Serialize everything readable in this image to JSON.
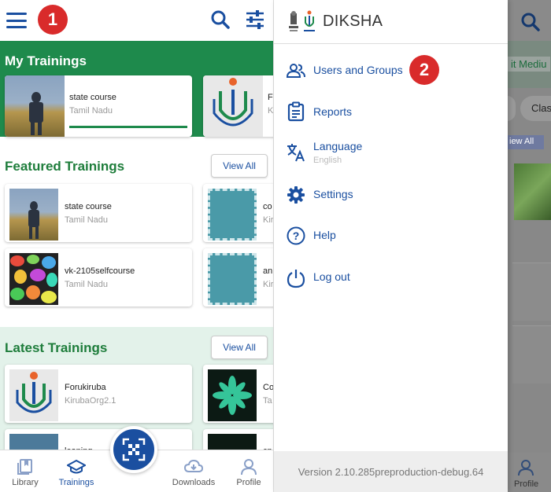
{
  "annotations": {
    "badge_1": "1",
    "badge_2": "2"
  },
  "sections": {
    "my_trainings": {
      "title": "My Trainings",
      "cards": [
        {
          "title": "state course",
          "subtitle": "Tamil Nadu"
        },
        {
          "title": "F",
          "subtitle": "K"
        }
      ]
    },
    "featured": {
      "title": "Featured Trainings",
      "view_all": "View All",
      "cards": [
        {
          "title": "state course",
          "subtitle": "Tamil Nadu"
        },
        {
          "title": "co",
          "subtitle": "Kir"
        },
        {
          "title": "vk-2105selfcourse",
          "subtitle": "Tamil Nadu"
        },
        {
          "title": "an",
          "subtitle": "Kir"
        }
      ]
    },
    "latest": {
      "title": "Latest Trainings",
      "view_all": "View All",
      "cards": [
        {
          "title": "Forukiruba",
          "subtitle": "KirubaOrg2.1"
        },
        {
          "title": "Co",
          "subtitle": "Ta"
        },
        {
          "title": "leaning",
          "subtitle": ""
        },
        {
          "title": "cp",
          "subtitle": ""
        }
      ]
    }
  },
  "bottom_nav": {
    "library": "Library",
    "trainings": "Trainings",
    "downloads": "Downloads",
    "profile": "Profile"
  },
  "drawer": {
    "brand": "DIKSHA",
    "items": [
      {
        "label": "Users and Groups",
        "icon": "users-icon"
      },
      {
        "label": "Reports",
        "icon": "clipboard-icon"
      },
      {
        "label": "Language",
        "sub": "English",
        "icon": "translate-icon"
      },
      {
        "label": "Settings",
        "icon": "gear-icon"
      },
      {
        "label": "Help",
        "icon": "help-icon"
      },
      {
        "label": "Log out",
        "icon": "power-icon"
      }
    ],
    "version": "Version 2.10.285preproduction-debug.64"
  },
  "scrim": {
    "chip_medium": "it Mediu",
    "chip_class": "Clas",
    "view_all": "iew All",
    "profile": "Profile"
  },
  "colors": {
    "primary": "#1a4fa0",
    "green": "#1e8a4c",
    "badge_red": "#d92b2b"
  }
}
